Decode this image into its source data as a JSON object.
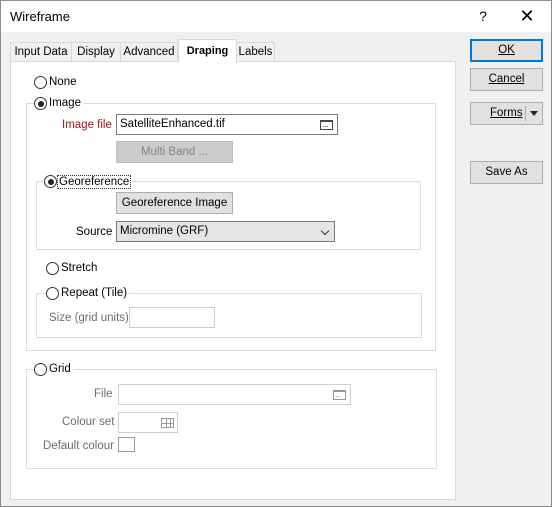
{
  "window": {
    "title": "Wireframe",
    "help_glyph": "?",
    "close_glyph": "✕"
  },
  "tabs": [
    {
      "label": "Input Data"
    },
    {
      "label": "Display"
    },
    {
      "label": "Advanced"
    },
    {
      "label": "Draping",
      "active": true
    },
    {
      "label": "Labels"
    }
  ],
  "draping": {
    "none_label": "None",
    "image": {
      "label": "Image",
      "image_file_label": "Image file",
      "image_file_value": "SatelliteEnhanced.tif",
      "multiband_label": "Multi Band ...",
      "georeference": {
        "label": "Georeference",
        "button_label": "Georeference Image",
        "source_label": "Source",
        "source_value": "Micromine (GRF)"
      },
      "stretch_label": "Stretch",
      "repeat": {
        "label": "Repeat (Tile)",
        "size_label": "Size (grid units)",
        "size_value": ""
      }
    },
    "grid": {
      "label": "Grid",
      "file_label": "File",
      "file_value": "",
      "colour_set_label": "Colour set",
      "colour_set_value": "",
      "default_colour_label": "Default colour"
    }
  },
  "side_buttons": {
    "ok": "OK",
    "cancel": "Cancel",
    "forms": "Forms",
    "save_as": "Save As"
  }
}
